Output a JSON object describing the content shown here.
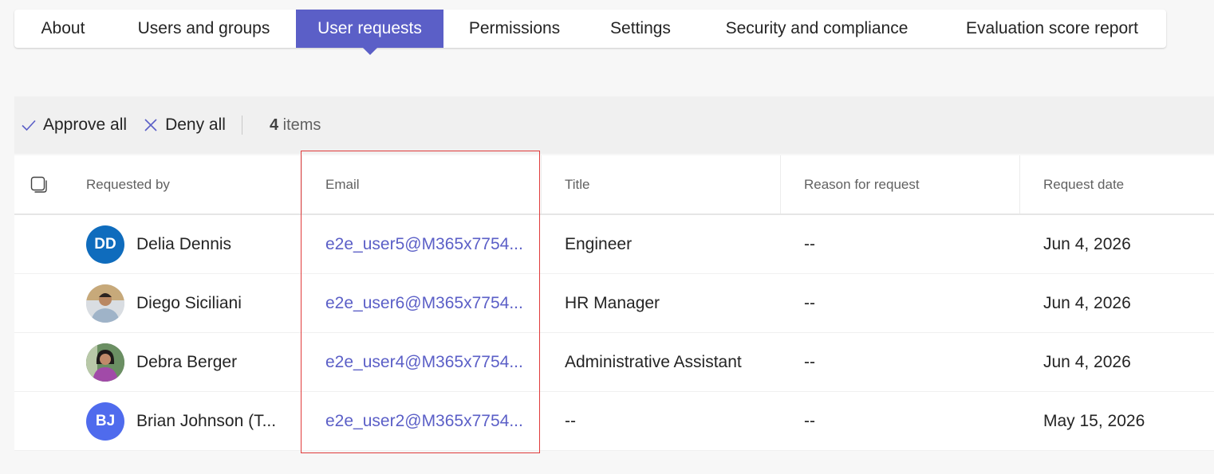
{
  "tabs": [
    {
      "label": "About"
    },
    {
      "label": "Users and groups"
    },
    {
      "label": "User requests",
      "active": true
    },
    {
      "label": "Permissions"
    },
    {
      "label": "Settings"
    },
    {
      "label": "Security and compliance"
    },
    {
      "label": "Evaluation score report"
    }
  ],
  "toolbar": {
    "approve_label": "Approve all",
    "deny_label": "Deny all",
    "count_number": "4",
    "count_suffix": "items"
  },
  "table": {
    "headers": {
      "requested_by": "Requested by",
      "email": "Email",
      "title": "Title",
      "reason": "Reason for request",
      "date": "Request date"
    },
    "rows": [
      {
        "name": "Delia Dennis",
        "initials": "DD",
        "avatar_color": "#0f6cbd",
        "email": "e2e_user5@M365x7754...",
        "title": "Engineer",
        "reason": "--",
        "date": "Jun 4, 2026"
      },
      {
        "name": "Diego Siciliani",
        "initials": "",
        "avatar_color": "#9aa3ad",
        "email": "e2e_user6@M365x7754...",
        "title": "HR Manager",
        "reason": "--",
        "date": "Jun 4, 2026"
      },
      {
        "name": "Debra Berger",
        "initials": "",
        "avatar_color": "#8b5a8c",
        "email": "e2e_user4@M365x7754...",
        "title": "Administrative Assistant",
        "reason": "--",
        "date": "Jun 4, 2026"
      },
      {
        "name": "Brian Johnson (T...",
        "initials": "BJ",
        "avatar_color": "#4f6bed",
        "email": "e2e_user2@M365x7754...",
        "title": "--",
        "reason": "--",
        "date": "May 15, 2026"
      }
    ]
  },
  "colors": {
    "accent": "#5b5fc7",
    "highlight": "#e03b3b"
  }
}
